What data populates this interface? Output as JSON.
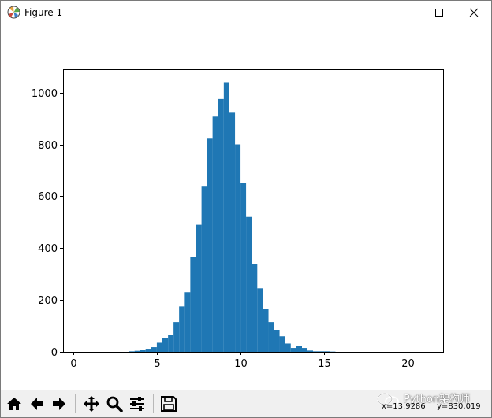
{
  "window": {
    "title": "Figure 1"
  },
  "toolbar": {
    "buttons": [
      "home",
      "back",
      "forward",
      "pan",
      "zoom",
      "configure-subplots",
      "save"
    ],
    "watermark": "Python架构师",
    "coord_x": "x=13.9286",
    "coord_y": "y=830.019"
  },
  "colors": {
    "bar": "#1f77b4",
    "toolbar_bg": "#f0f0f0"
  },
  "chart_data": {
    "type": "bar",
    "title": "",
    "xlabel": "",
    "ylabel": "",
    "xlim": [
      -0.6,
      22.1
    ],
    "ylim": [
      0,
      1090
    ],
    "xticks": [
      0,
      5,
      10,
      15,
      20
    ],
    "yticks": [
      0,
      200,
      400,
      600,
      800,
      1000
    ],
    "grid": false,
    "legend": "none",
    "bin_edges": [
      3.33,
      3.67,
      4.0,
      4.33,
      4.67,
      5.0,
      5.33,
      5.67,
      6.0,
      6.33,
      6.67,
      7.0,
      7.33,
      7.67,
      8.0,
      8.33,
      8.67,
      9.0,
      9.33,
      9.67,
      10.0,
      10.33,
      10.67,
      11.0,
      11.33,
      11.67,
      12.0,
      12.33,
      12.67,
      13.0,
      13.33,
      13.67,
      14.0,
      14.33,
      14.67,
      15.0,
      15.33,
      15.67,
      16.0,
      16.33,
      16.67,
      17.0
    ],
    "values": [
      2,
      4,
      7,
      12,
      18,
      35,
      52,
      65,
      115,
      175,
      230,
      365,
      490,
      640,
      825,
      910,
      975,
      1040,
      925,
      800,
      650,
      520,
      340,
      245,
      165,
      115,
      85,
      60,
      32,
      15,
      22,
      15,
      5,
      2,
      2,
      2,
      1,
      0,
      0,
      0,
      0
    ]
  }
}
